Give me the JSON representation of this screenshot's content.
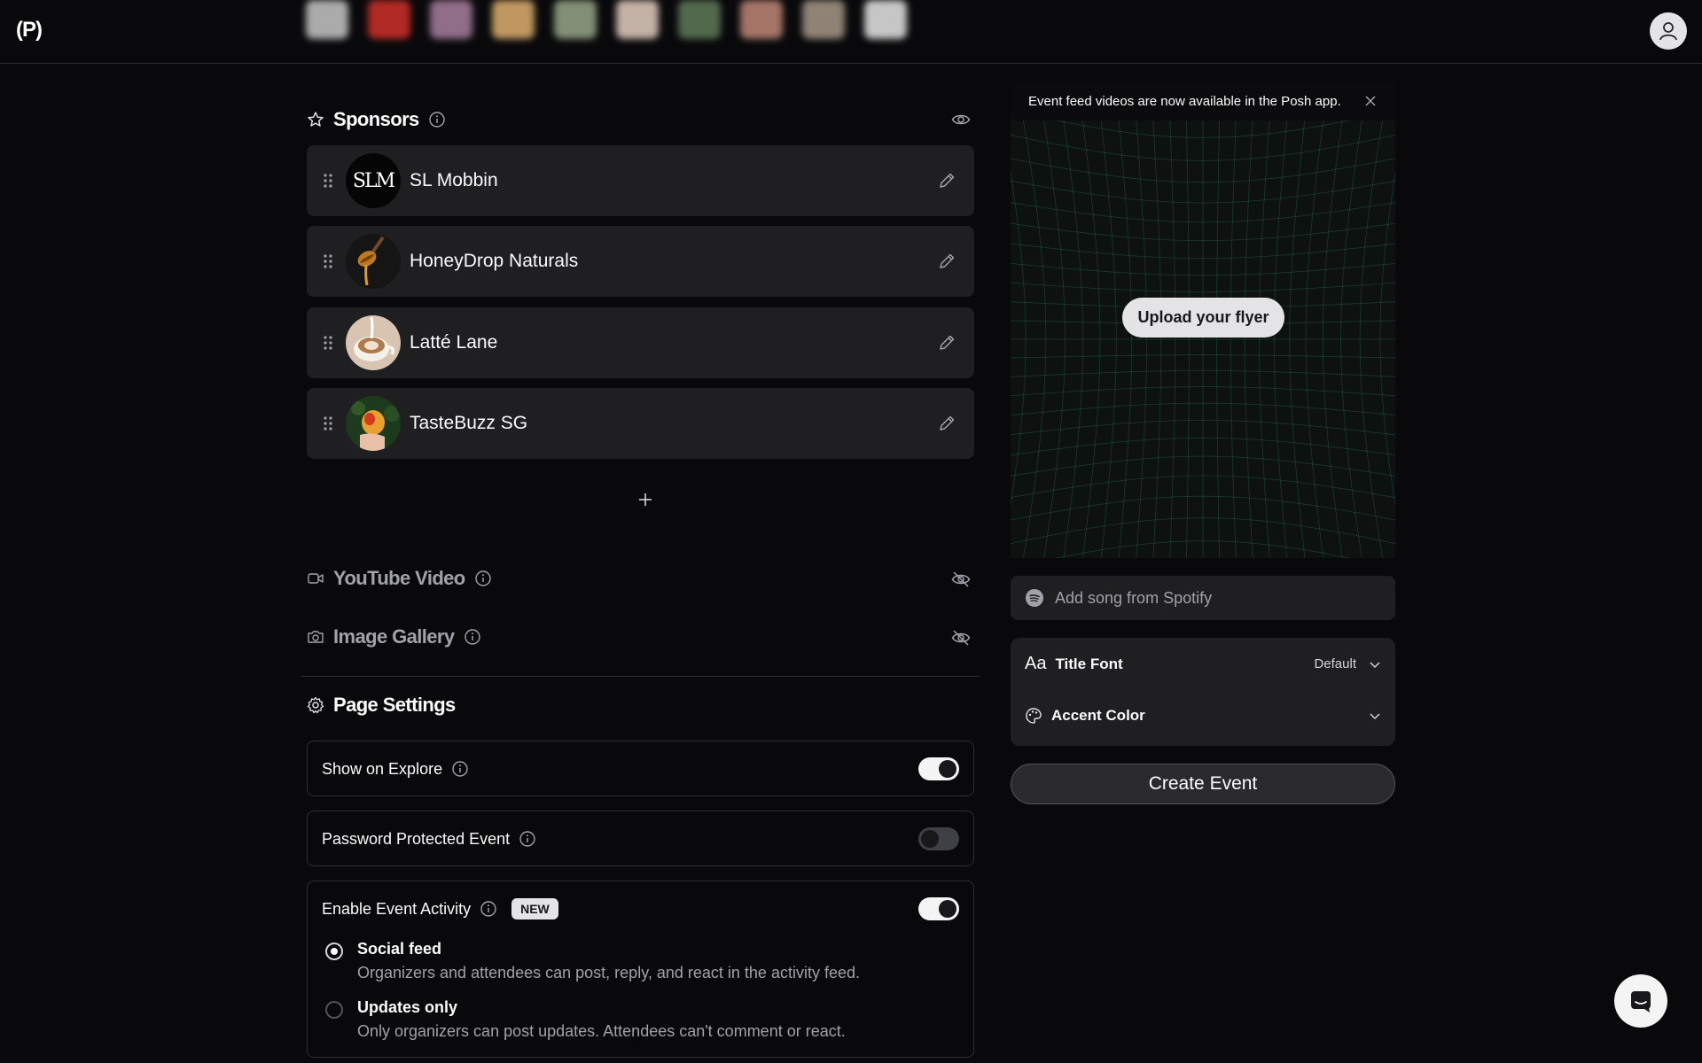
{
  "app": {
    "logo_text": "(P)"
  },
  "header": {
    "strip_colors": [
      "#c8c8c8",
      "#d0302a",
      "#a87fa0",
      "#e0b070",
      "#98a888",
      "#e4d0c0",
      "#607a58",
      "#c08878",
      "#a89888",
      "#e8e8e8"
    ]
  },
  "sponsors": {
    "title": "Sponsors",
    "items": [
      {
        "name": "SL Mobbin",
        "logo_text": "SLM"
      },
      {
        "name": "HoneyDrop Naturals"
      },
      {
        "name": "Latté Lane"
      },
      {
        "name": "TasteBuzz SG"
      }
    ]
  },
  "youtube": {
    "title": "YouTube Video"
  },
  "gallery": {
    "title": "Image Gallery"
  },
  "page_settings": {
    "title": "Page Settings",
    "show_on_explore": {
      "label": "Show on Explore",
      "enabled": true
    },
    "password_protected": {
      "label": "Password Protected Event",
      "enabled": false
    },
    "event_activity": {
      "label": "Enable Event Activity",
      "badge": "NEW",
      "enabled": true,
      "options": [
        {
          "title": "Social feed",
          "description": "Organizers and attendees can post, reply, and react in the activity feed.",
          "selected": true
        },
        {
          "title": "Updates only",
          "description": "Only organizers can post updates. Attendees can't comment or react.",
          "selected": false
        }
      ]
    }
  },
  "right": {
    "banner": "Event feed videos are now available in the Posh app.",
    "upload_label": "Upload your flyer",
    "spotify_placeholder": "Add song from Spotify",
    "title_font": {
      "label": "Title Font",
      "icon_text": "Aa",
      "value": "Default"
    },
    "accent_color": {
      "label": "Accent Color"
    },
    "create_label": "Create Event"
  },
  "colors": {
    "background": "#09090b",
    "card": "#1f1f22",
    "grid": "#3fa07a"
  }
}
